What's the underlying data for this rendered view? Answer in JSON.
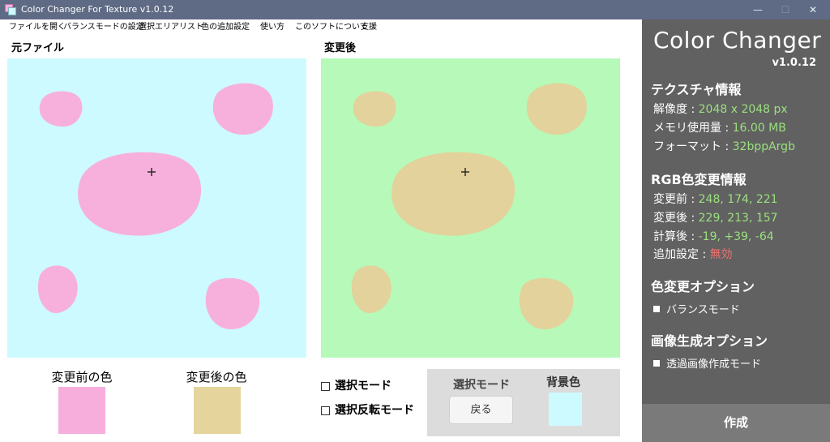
{
  "window": {
    "title": "Color Changer For Texture v1.0.12",
    "buttons": {
      "minimize": "—",
      "maximize": "☐",
      "close": "✕"
    }
  },
  "menu": [
    "ファイルを開く",
    "バランスモードの設定",
    "選択エリアリスト",
    "色の追加設定",
    "使い方",
    "このソフトについて",
    "支援"
  ],
  "original": {
    "label": "元ファイル",
    "bg_color": "#cdfaff",
    "blob_color": "#f7b0dc"
  },
  "changed": {
    "label": "変更後",
    "bg_color": "#b6f9b8",
    "blob_color": "#e3d29b"
  },
  "swatches": {
    "before": {
      "label": "変更前の色",
      "color": "#f7aedd"
    },
    "after": {
      "label": "変更後の色",
      "color": "#e5d59d"
    }
  },
  "options": {
    "select_mode": {
      "label": "選択モード",
      "checked": false
    },
    "invert_select_mode": {
      "label": "選択反転モード",
      "checked": false
    }
  },
  "select_panel": {
    "label": "選択モード",
    "back_button": "戻る",
    "bg_label": "背景色",
    "bg_color": "#cdfaff"
  },
  "sidebar": {
    "app_name": "Color Changer",
    "version": "v1.0.12",
    "texture_info": {
      "heading": "テクスチャ情報",
      "resolution_label": "解像度 :",
      "resolution_value": "2048 x 2048 px",
      "memory_label": "メモリ使用量 :",
      "memory_value": "16.00 MB",
      "format_label": "フォーマット :",
      "format_value": "32bppArgb"
    },
    "rgb_info": {
      "heading": "RGB色変更情報",
      "before_label": "変更前 :",
      "before_value": "248, 174, 221",
      "after_label": "変更後 :",
      "after_value": "229, 213, 157",
      "calc_label": "計算後 :",
      "calc_value": "-19, +39, -64",
      "extra_label": "追加設定 :",
      "extra_value": "無効"
    },
    "color_options": {
      "heading": "色変更オプション",
      "balance_mode": "バランスモード"
    },
    "image_options": {
      "heading": "画像生成オプション",
      "transparent_mode": "透過画像作成モード"
    },
    "create_button": "作成"
  }
}
